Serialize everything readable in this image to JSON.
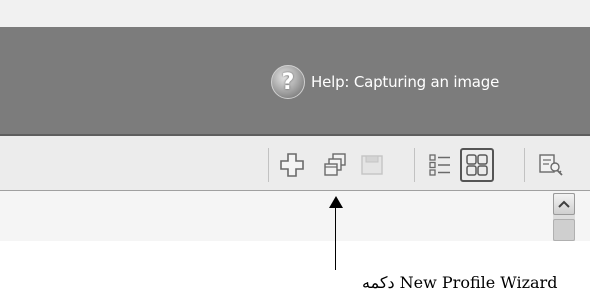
{
  "header": {
    "help_label": "Help: Capturing an image",
    "help_icon": "question-circle-icon",
    "help_icon_glyph": "?"
  },
  "toolbar": {
    "buttons": [
      {
        "name": "new-profile-button",
        "icon": "plus-icon"
      },
      {
        "name": "new-profile-wizard-button",
        "icon": "stacked-windows-icon"
      },
      {
        "name": "save-button",
        "icon": "floppy-disk-icon"
      },
      {
        "name": "details-view-button",
        "icon": "list-view-icon"
      },
      {
        "name": "thumbnails-view-button",
        "icon": "grid-view-icon"
      },
      {
        "name": "profile-settings-button",
        "icon": "profile-key-icon"
      }
    ]
  },
  "annotation": {
    "caption": "دکمه New Profile Wizard"
  },
  "colors": {
    "header_bg": "#7c7c7c",
    "toolbar_bg": "#ececec",
    "help_text": "#ffffff"
  }
}
